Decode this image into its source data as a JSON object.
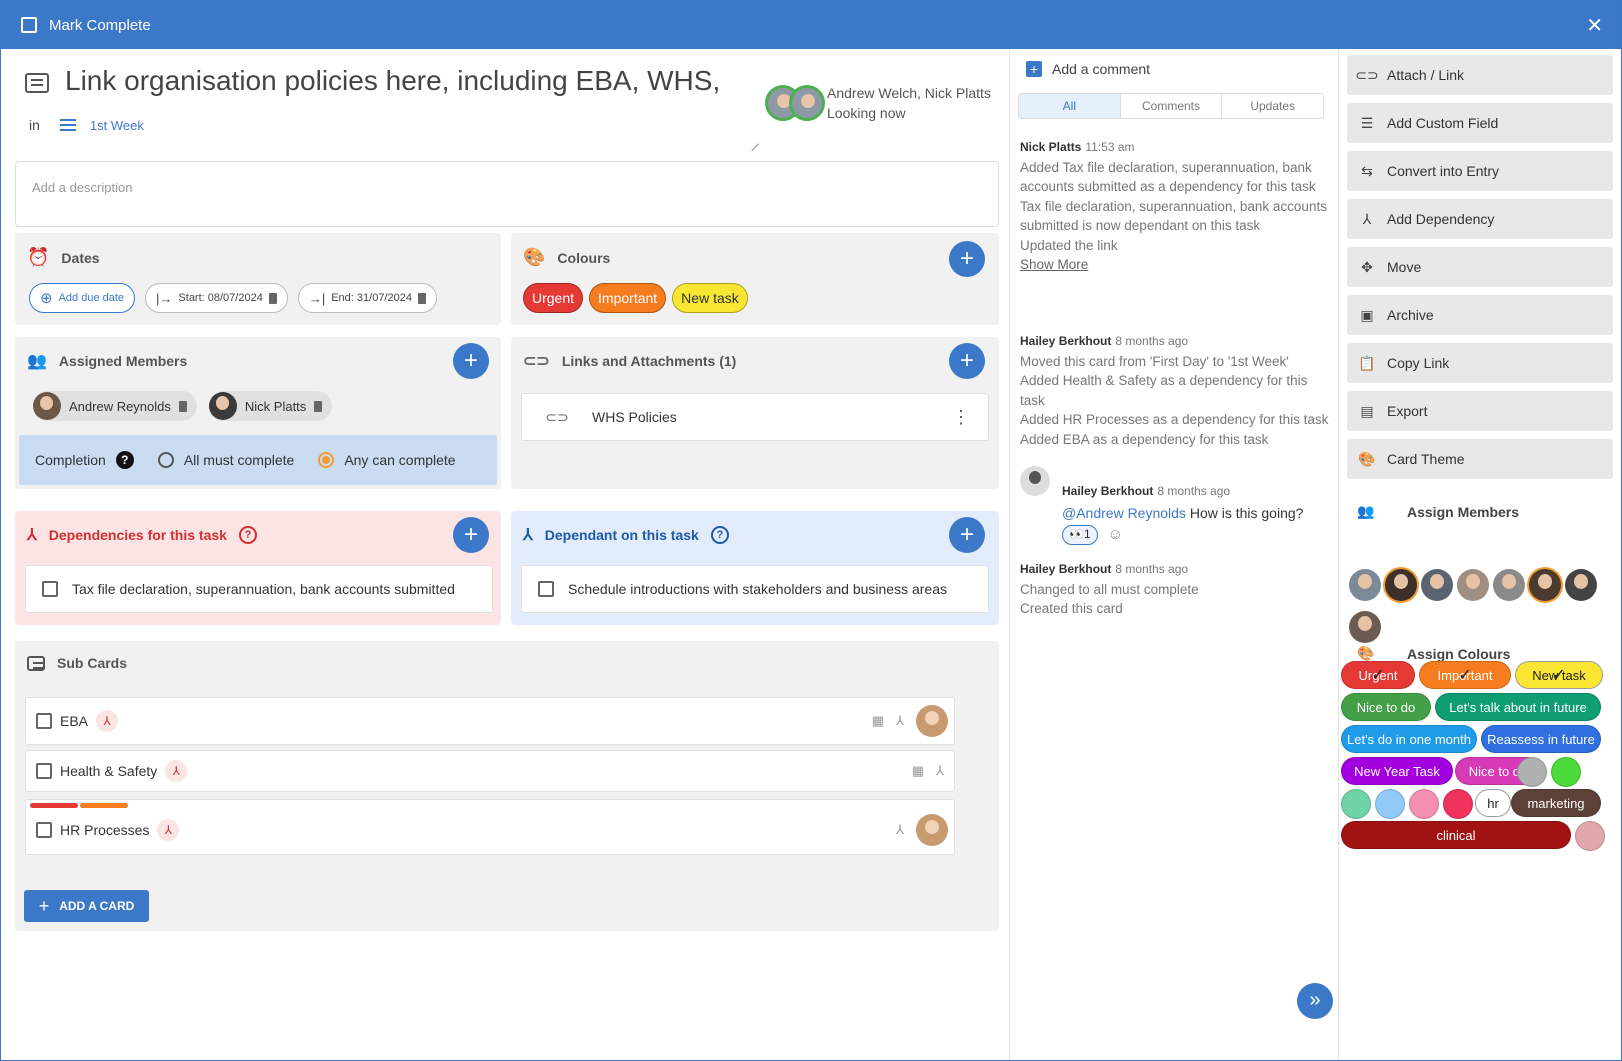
{
  "window": {
    "title": "Mark Complete"
  },
  "card": {
    "title": "Link organisation policies here, including EBA, WHS,",
    "in_label": "in",
    "list_name": "1st Week",
    "viewers": "Andrew Welch, Nick Platts",
    "viewers_status": "Looking now",
    "description_placeholder": "Add a description"
  },
  "dates": {
    "title": "Dates",
    "add_due": "Add due date",
    "start": "Start: 08/07/2024",
    "end": "End: 31/07/2024"
  },
  "colours": {
    "title": "Colours",
    "tags": [
      {
        "label": "Urgent",
        "bg": "#e53935",
        "fg": "#ffffff"
      },
      {
        "label": "Important",
        "bg": "#f57c1f",
        "fg": "#ffffff"
      },
      {
        "label": "New task",
        "bg": "#f9e633",
        "fg": "#333333"
      }
    ]
  },
  "members": {
    "title": "Assigned Members",
    "list": [
      "Andrew Reynolds",
      "Nick Platts"
    ],
    "completion_label": "Completion",
    "opt_all": "All must complete",
    "opt_any": "Any can complete"
  },
  "links": {
    "title": "Links and Attachments (1)",
    "items": [
      "WHS Policies"
    ]
  },
  "deps": {
    "title": "Dependencies for this task",
    "item": "Tax file declaration, superannuation, bank accounts submitted"
  },
  "dependant": {
    "title": "Dependant on this task",
    "item": "Schedule introductions with stakeholders and business areas"
  },
  "subcards": {
    "title": "Sub Cards",
    "items": [
      "EBA",
      "Health & Safety",
      "HR Processes"
    ],
    "add_label": "ADD A CARD"
  },
  "comments": {
    "add_label": "Add a comment",
    "tabs": [
      "All",
      "Comments",
      "Updates"
    ],
    "a1_who": "Nick Platts",
    "a1_when": "11:53 am",
    "a1_l1": "Added Tax file declaration, superannuation, bank accounts submitted as a dependency for this task",
    "a1_l2": "Tax file declaration, superannuation, bank accounts submitted is now dependant on this task",
    "a1_l3": "Updated the link",
    "show_more": "Show More",
    "a2_who": "Hailey Berkhout",
    "a2_when": "8 months ago",
    "a2_l1": "Moved this card from 'First Day' to '1st Week'",
    "a2_l2": "Added Health & Safety as a dependency for this task",
    "a2_l3": "Added HR Processes as a dependency for this task",
    "a2_l4": "Added EBA as a dependency for this task",
    "c3_who": "Hailey Berkhout",
    "c3_when": "8 months ago",
    "c3_mention": "@Andrew Reynolds",
    "c3_text": " How is this going?",
    "c3_react": "1",
    "a4_who": "Hailey Berkhout",
    "a4_when": "8 months ago",
    "a4_l1": "Changed to all must complete",
    "a4_l2": "Created this card"
  },
  "side": {
    "buttons": [
      "Attach / Link",
      "Add Custom Field",
      "Convert into Entry",
      "Add Dependency",
      "Move",
      "Archive",
      "Copy Link",
      "Export",
      "Card Theme"
    ],
    "assign_members": "Assign Members",
    "assign_colours": "Assign Colours",
    "chips": [
      {
        "label": "Urgent",
        "bg": "#e53935"
      },
      {
        "label": "Important",
        "bg": "#f57c1f"
      },
      {
        "label": "New task",
        "bg": "#f9e633"
      },
      {
        "label": "Nice to do",
        "bg": "#43a047"
      },
      {
        "label": "Let's talk about in future",
        "bg": "#0f9d74"
      },
      {
        "label": "Let's do in one month",
        "bg": "#1e9be9"
      },
      {
        "label": "Reassess in future",
        "bg": "#2f6fe0"
      },
      {
        "label": "New Year Task",
        "bg": "#a300e0"
      },
      {
        "label": "Nice to do",
        "bg": "#d63ab7"
      },
      {
        "label": "hr",
        "bg": "#ffffff"
      },
      {
        "label": "marketing",
        "bg": "#5d4037"
      },
      {
        "label": "clinical",
        "bg": "#a31212"
      }
    ]
  }
}
